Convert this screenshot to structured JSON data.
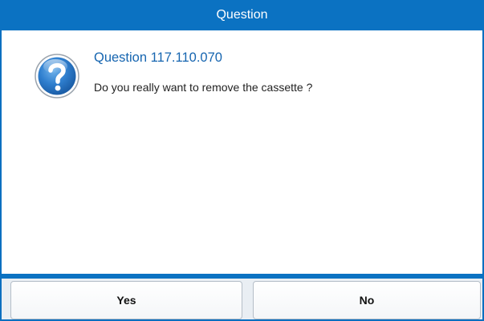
{
  "window": {
    "title": "Question"
  },
  "message": {
    "icon": "question-icon",
    "title": "Question 117.110.070",
    "text": "Do you really want to remove the cassette ?"
  },
  "buttons": {
    "yes_label": "Yes",
    "no_label": "No"
  },
  "colors": {
    "accent": "#0b72c2",
    "title_text": "#1665b0"
  }
}
